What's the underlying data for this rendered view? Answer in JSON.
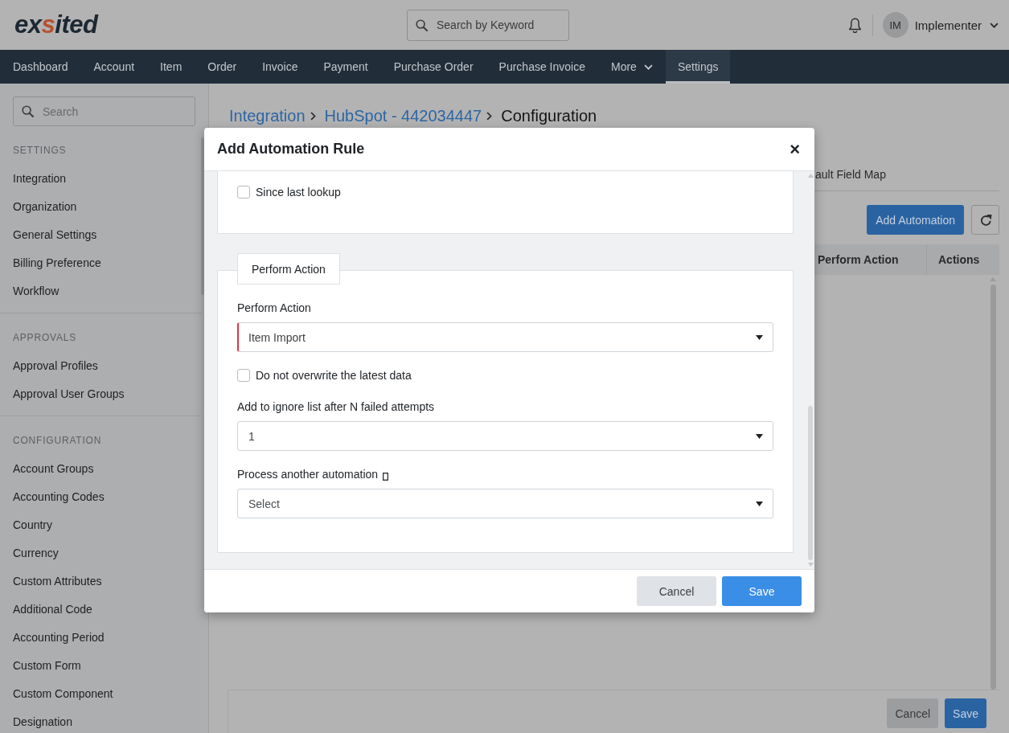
{
  "header": {
    "logo": "exsited",
    "search": {
      "placeholder": "Search by Keyword"
    },
    "user": {
      "initials": "IM",
      "name": "Implementer"
    }
  },
  "nav": [
    {
      "label": "Dashboard",
      "selected": false,
      "dropdown": false
    },
    {
      "label": "Account",
      "selected": false,
      "dropdown": false
    },
    {
      "label": "Item",
      "selected": false,
      "dropdown": false
    },
    {
      "label": "Order",
      "selected": false,
      "dropdown": false
    },
    {
      "label": "Invoice",
      "selected": false,
      "dropdown": false
    },
    {
      "label": "Payment",
      "selected": false,
      "dropdown": false
    },
    {
      "label": "Purchase Order",
      "selected": false,
      "dropdown": false
    },
    {
      "label": "Purchase Invoice",
      "selected": false,
      "dropdown": false
    },
    {
      "label": "More",
      "selected": false,
      "dropdown": true
    },
    {
      "label": "Settings",
      "selected": true,
      "dropdown": false
    }
  ],
  "sidebar": {
    "search": {
      "placeholder": "Search"
    },
    "sections": [
      {
        "title": "SETTINGS",
        "items": [
          "Integration",
          "Organization",
          "General Settings",
          "Billing Preference",
          "Workflow"
        ]
      },
      {
        "title": "APPROVALS",
        "items": [
          "Approval Profiles",
          "Approval User Groups"
        ]
      },
      {
        "title": "CONFIGURATION",
        "items": [
          "Account Groups",
          "Accounting Codes",
          "Country",
          "Currency",
          "Custom Attributes",
          "Additional Code",
          "Accounting Period",
          "Custom Form",
          "Custom Component",
          "Designation"
        ]
      }
    ]
  },
  "main": {
    "breadcrumb": [
      {
        "label": "Integration",
        "kind": "link"
      },
      {
        "label": "HubSpot - 442034447",
        "kind": "link"
      },
      {
        "label": "Configuration",
        "kind": "current"
      }
    ],
    "tab": "ault Field Map",
    "add_button": "Add Automation",
    "table": {
      "columns": [
        "Perform Action",
        "Actions"
      ]
    },
    "footer_buttons": [
      {
        "label": "Cancel",
        "kind": "secondary"
      },
      {
        "label": "Save",
        "kind": "primary"
      }
    ]
  },
  "modal": {
    "title": "Add Automation Rule",
    "close": "×",
    "cards": [
      {
        "fields": [
          {
            "kind": "checkbox",
            "label": "Since last lookup",
            "checked": false
          }
        ]
      },
      {
        "tab": "Perform Action",
        "fields": [
          {
            "kind": "select",
            "label": "Perform Action",
            "value": "Item Import",
            "required": true,
            "label_icon": false
          },
          {
            "kind": "checkbox",
            "label": "Do not overwrite the latest data",
            "checked": false
          },
          {
            "kind": "select",
            "label": "Add to ignore list after N failed attempts",
            "value": "1",
            "required": false,
            "label_icon": false
          },
          {
            "kind": "select",
            "label": "Process another automation",
            "placeholder": "Select",
            "required": false,
            "label_icon": true
          }
        ]
      }
    ],
    "buttons": [
      {
        "label": "Cancel",
        "kind": "secondary"
      },
      {
        "label": "Save",
        "kind": "primary"
      }
    ]
  }
}
